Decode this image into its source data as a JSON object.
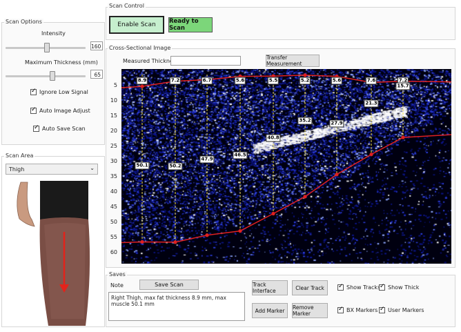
{
  "scan_options": {
    "title": "Scan Options",
    "intensity_label": "Intensity",
    "intensity_value": "160",
    "intensity_level": 0.63,
    "max_thickness_label": "Maximum Thickness (mm)",
    "max_thickness_value": "65",
    "max_thickness_level": 0.39,
    "checkboxes": [
      {
        "label": "Ignore Low Signal",
        "checked": true
      },
      {
        "label": "Auto Image Adjust",
        "checked": true
      },
      {
        "label": "Auto Save Scan",
        "checked": true
      }
    ]
  },
  "scan_area": {
    "title": "Scan Area",
    "selected": "Thigh"
  },
  "scan_control": {
    "title": "Scan Control",
    "enable_label": "Enable Scan",
    "status_label": "Ready to Scan",
    "enable_color": "#c6efce",
    "status_color": "#7cd67a"
  },
  "cross_section": {
    "title": "Cross-Sectional Image",
    "measured_label": "Measured Thickness",
    "measured_value": "",
    "transfer_label": "Transfer Measurement",
    "y_ticks": [
      "5",
      "10",
      "15",
      "20",
      "25",
      "30",
      "35",
      "40",
      "45",
      "50",
      "55",
      "60"
    ],
    "fat_labels": [
      "8.9",
      "7.2",
      "6.7",
      "5.6",
      "5.5",
      "5.2",
      "5.6",
      "7.6",
      "7.2"
    ],
    "muscle_labels": [
      "50.1",
      "50.2",
      "47.9",
      "46.5",
      "40.8",
      "35.2",
      "27.9",
      "21.3",
      "15.7"
    ],
    "track_color": "#e02020",
    "marker_line_color": "#f5e04a"
  },
  "saves": {
    "title": "Saves",
    "note_label": "Note",
    "save_label": "Save Scan",
    "note_text": "Right Thigh, max fat thickness 8.9 mm,  max muscle 50.1 mm",
    "track_interface_label": "Track Interface",
    "clear_track_label": "Clear Track",
    "add_marker_label": "Add Marker",
    "remove_marker_label": "Remove Marker",
    "options": [
      {
        "label": "Show Tracks",
        "checked": true
      },
      {
        "label": "Show Thick",
        "checked": true
      },
      {
        "label": "BX Markers",
        "checked": true
      },
      {
        "label": "User Markers",
        "checked": true
      }
    ]
  }
}
